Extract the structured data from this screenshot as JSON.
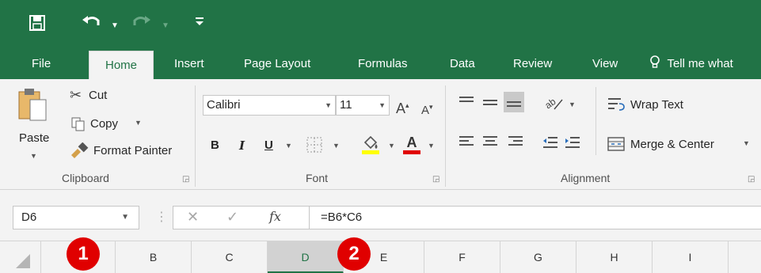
{
  "quick_access": {
    "save_icon": "save-icon",
    "undo_icon": "undo-icon",
    "redo_icon": "redo-icon",
    "customize_icon": "customize-icon"
  },
  "tabs": [
    {
      "label": "File",
      "active": false
    },
    {
      "label": "Home",
      "active": true
    },
    {
      "label": "Insert",
      "active": false
    },
    {
      "label": "Page Layout",
      "active": false
    },
    {
      "label": "Formulas",
      "active": false
    },
    {
      "label": "Data",
      "active": false
    },
    {
      "label": "Review",
      "active": false
    },
    {
      "label": "View",
      "active": false
    },
    {
      "label": "Tell me what",
      "active": false
    }
  ],
  "clipboard": {
    "paste": "Paste",
    "cut": "Cut",
    "copy": "Copy",
    "format_painter": "Format Painter",
    "label": "Clipboard"
  },
  "font": {
    "family": "Calibri",
    "size": "11",
    "bold": "B",
    "italic": "I",
    "underline": "U",
    "label": "Font"
  },
  "alignment": {
    "wrap_text": "Wrap Text",
    "merge_center": "Merge & Center",
    "label": "Alignment"
  },
  "formula_bar": {
    "name_box": "D6",
    "formula": "=B6*C6",
    "fx": "fx"
  },
  "columns": [
    "B",
    "C",
    "D",
    "E",
    "F",
    "G",
    "H",
    "I"
  ],
  "active_column": "D",
  "callouts": [
    "1",
    "2"
  ],
  "colors": {
    "accent": "#217346",
    "callout": "#e00000",
    "font_color_bar": "#e00000",
    "fill_color_bar": "#ffff00"
  }
}
